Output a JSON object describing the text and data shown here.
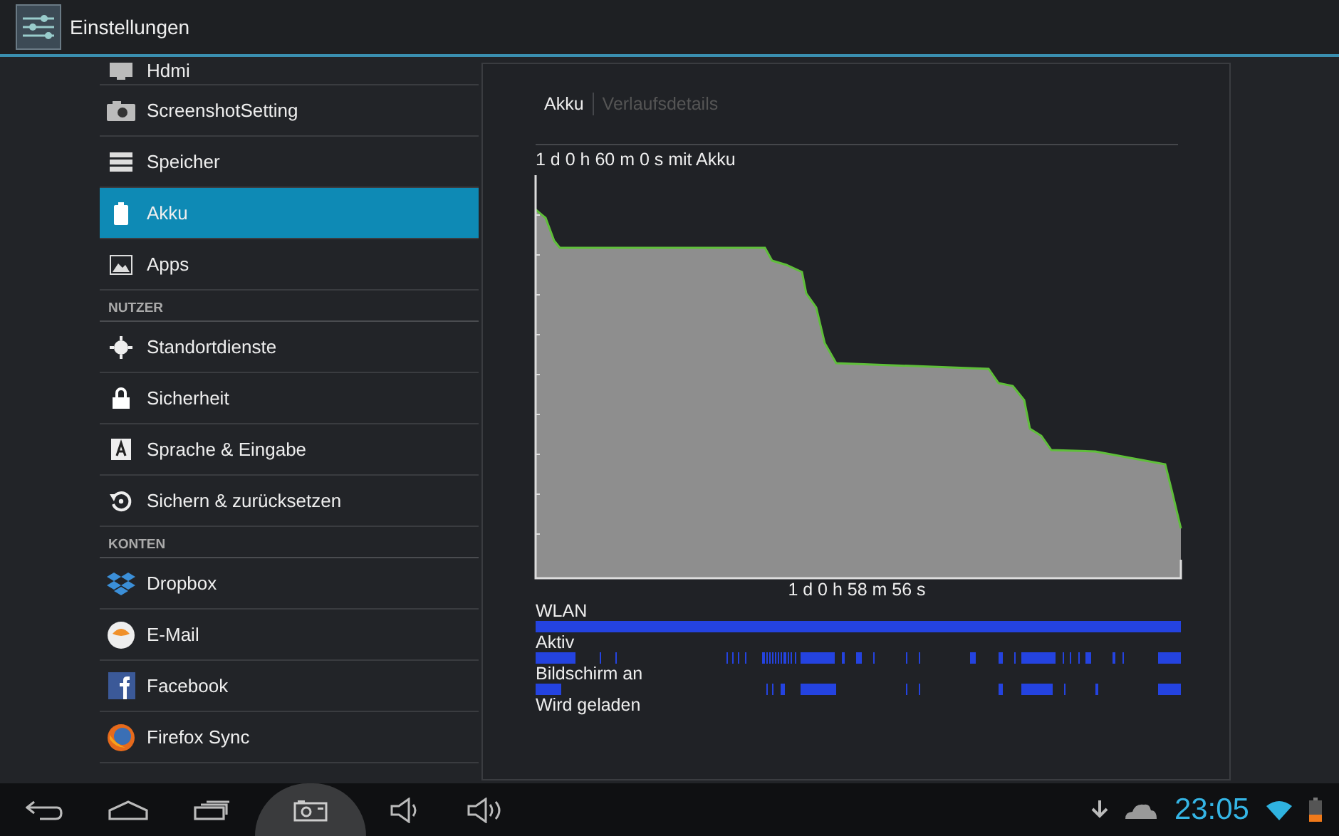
{
  "action_bar": {
    "title": "Einstellungen"
  },
  "sidebar": {
    "items": [
      {
        "kind": "item",
        "label": "Hdmi",
        "selected": false
      },
      {
        "kind": "item",
        "label": "ScreenshotSetting",
        "selected": false
      },
      {
        "kind": "item",
        "label": "Speicher",
        "selected": false
      },
      {
        "kind": "item",
        "label": "Akku",
        "selected": true
      },
      {
        "kind": "item",
        "label": "Apps",
        "selected": false
      },
      {
        "kind": "header",
        "label": "NUTZER"
      },
      {
        "kind": "item",
        "label": "Standortdienste",
        "selected": false
      },
      {
        "kind": "item",
        "label": "Sicherheit",
        "selected": false
      },
      {
        "kind": "item",
        "label": "Sprache & Eingabe",
        "selected": false
      },
      {
        "kind": "item",
        "label": "Sichern & zurücksetzen",
        "selected": false
      },
      {
        "kind": "header",
        "label": "KONTEN"
      },
      {
        "kind": "item",
        "label": "Dropbox",
        "selected": false
      },
      {
        "kind": "item",
        "label": "E-Mail",
        "selected": false
      },
      {
        "kind": "item",
        "label": "Facebook",
        "selected": false
      },
      {
        "kind": "item",
        "label": "Firefox Sync",
        "selected": false
      }
    ]
  },
  "panel": {
    "tabs": [
      {
        "label": "Akku",
        "selected": true
      },
      {
        "label": "Verlaufsdetails",
        "selected": false
      }
    ],
    "chart_caption": "1 d 0 h 60 m 0 s mit Akku",
    "duration": "1 d 0 h 58 m 56 s",
    "timelines": [
      {
        "label": "WLAN"
      },
      {
        "label": "Aktiv"
      },
      {
        "label": "Bildschirm an"
      },
      {
        "label": "Wird geladen"
      }
    ]
  },
  "status_bar": {
    "time": "23:05"
  }
}
